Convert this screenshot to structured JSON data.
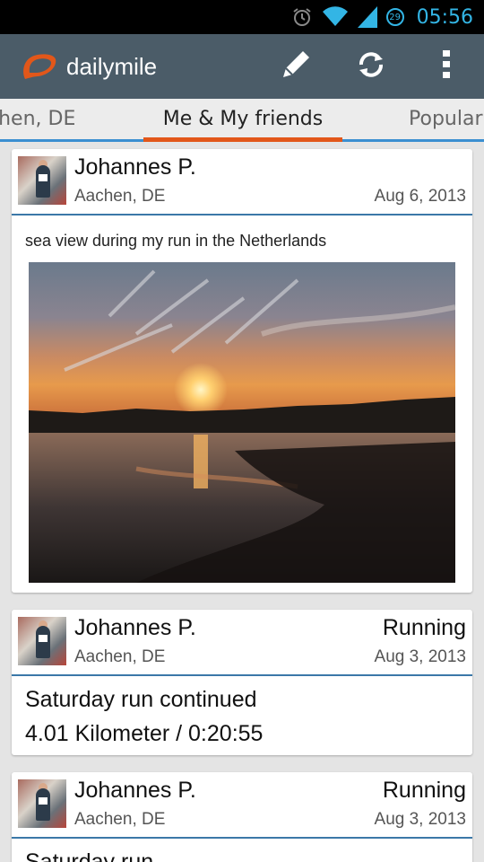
{
  "status_bar": {
    "time": "05:56",
    "battery_level": "29",
    "icons": [
      "alarm-icon",
      "wifi-icon",
      "signal-icon",
      "battery-icon"
    ]
  },
  "app": {
    "title": "dailymile",
    "actions": [
      "compose-icon",
      "refresh-icon",
      "overflow-menu-icon"
    ],
    "brand_color": "#e2571a",
    "bar_color": "#4b5c68"
  },
  "tabs": {
    "left": "chen, DE",
    "center": "Me & My friends",
    "right": "Popular",
    "accent": "#3b8fd1",
    "indicator": "#e2571a"
  },
  "feed": [
    {
      "name": "Johannes P.",
      "location": "Aachen, DE",
      "date": "Aug 6, 2013",
      "caption": "sea view during my run in the Netherlands"
    },
    {
      "name": "Johannes P.",
      "activity": "Running",
      "location": "Aachen, DE",
      "date": "Aug 3, 2013",
      "title": "Saturday run continued",
      "stats": "4.01 Kilometer / 0:20:55"
    },
    {
      "name": "Johannes P.",
      "activity": "Running",
      "location": "Aachen, DE",
      "date": "Aug 3, 2013",
      "title": "Saturday run"
    }
  ]
}
